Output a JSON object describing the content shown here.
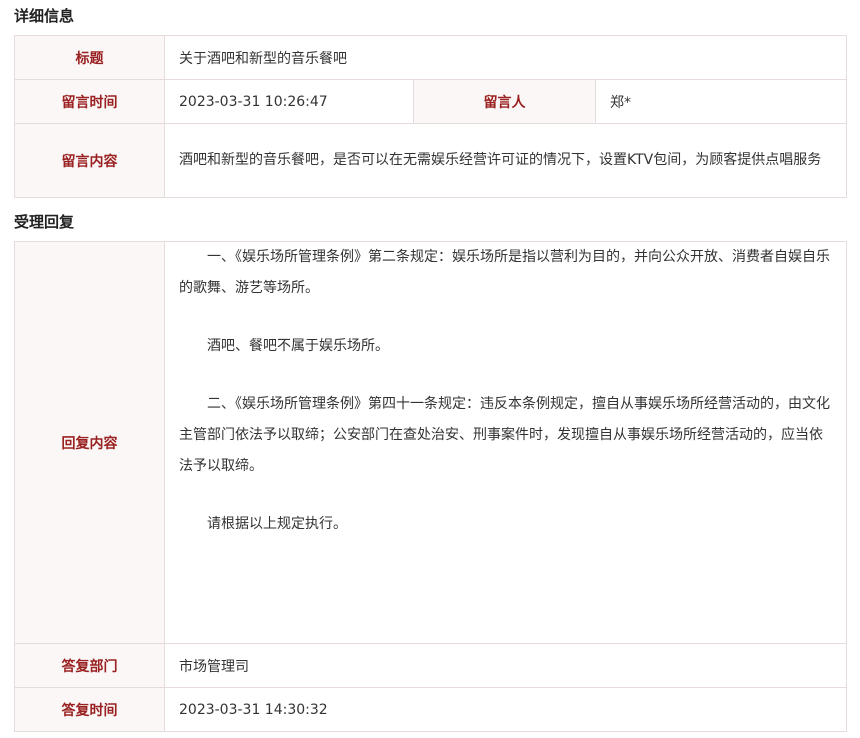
{
  "detail": {
    "section_title": "详细信息",
    "title_label": "标题",
    "title_value": "关于酒吧和新型的音乐餐吧",
    "time_label": "留言时间",
    "time_value": "2023-03-31 10:26:47",
    "author_label": "留言人",
    "author_value": "郑*",
    "content_label": "留言内容",
    "content_value": "酒吧和新型的音乐餐吧，是否可以在无需娱乐经营许可证的情况下，设置KTV包间，为顾客提供点唱服务"
  },
  "reply": {
    "section_title": "受理回复",
    "content_label": "回复内容",
    "paragraphs": [
      "一、《娱乐场所管理条例》第二条规定：娱乐场所是指以营利为目的，并向公众开放、消费者自娱自乐的歌舞、游艺等场所。",
      "酒吧、餐吧不属于娱乐场所。",
      "二、《娱乐场所管理条例》第四十一条规定：违反本条例规定，擅自从事娱乐场所经营活动的，由文化主管部门依法予以取缔；公安部门在查处治安、刑事案件时，发现擅自从事娱乐场所经营活动的，应当依法予以取缔。",
      "请根据以上规定执行。"
    ],
    "dept_label": "答复部门",
    "dept_value": "市场管理司",
    "time_label": "答复时间",
    "time_value": "2023-03-31 14:30:32"
  },
  "colors": {
    "label_text": "#9a2121",
    "label_bg": "#fbf7f7",
    "border": "#e6dcdc"
  }
}
